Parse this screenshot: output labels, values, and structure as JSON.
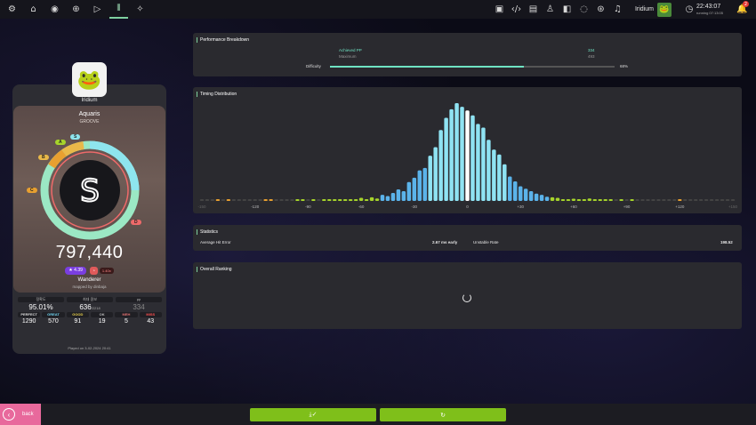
{
  "toolbar": {
    "left_icons": [
      "gear-icon",
      "home-icon",
      "record-icon",
      "discord-icon",
      "play-icon",
      "beatmap-listing-icon",
      "compass-icon"
    ],
    "right_icons": [
      "screenshot-icon",
      "code-icon",
      "news-icon",
      "rankings-icon",
      "beatmap-icon",
      "chat-icon",
      "direct-icon",
      "music-icon"
    ],
    "user_name": "Iridium",
    "clock_time": "22:43:07",
    "clock_sub": "running 07:13:05",
    "notification_count": "2"
  },
  "player": {
    "name": "Iridium"
  },
  "beatmap": {
    "title": "Aquaris",
    "difficulty": "GROOVE",
    "grade": "S",
    "grade_labels": [
      "S",
      "A",
      "B",
      "C",
      "D"
    ],
    "score": "797,440",
    "star_rating": "★ 4.39",
    "mods_label": "1.40x",
    "mapper": "Wanderer",
    "mapped_by_line": "mapped by dinbaja",
    "stats": [
      {
        "label": "정확도",
        "value": "95.01%",
        "extra": ""
      },
      {
        "label": "최대 콤보",
        "value": "636",
        "extra": "/2218"
      },
      {
        "label": "pp",
        "value": "334",
        "extra": ""
      }
    ],
    "judgements": [
      {
        "label": "PERFECT",
        "value": "1290",
        "color": "#dcdcdc"
      },
      {
        "label": "GREAT",
        "value": "570",
        "color": "#6fd3f0"
      },
      {
        "label": "GOOD",
        "value": "91",
        "color": "#e8d04a"
      },
      {
        "label": "OK",
        "value": "19",
        "color": "#bbbbbb"
      },
      {
        "label": "MEH",
        "value": "5",
        "color": "#e07070"
      },
      {
        "label": "MISS",
        "value": "43",
        "color": "#ff5050"
      }
    ],
    "played_on": "Played on 3-02-2024 20:41"
  },
  "performance": {
    "title": "Performance Breakdown",
    "achieved_label": "Achieved PP",
    "achieved_value": "334",
    "maximum_label": "Maximum",
    "maximum_value": "493",
    "difficulty_label": "Difficulty",
    "difficulty_value": "68%",
    "difficulty_fraction": 0.68
  },
  "timing": {
    "title": "Timing Distribution"
  },
  "statistics": {
    "title": "Statistics",
    "avg_hit_error_label": "Average Hit Error",
    "avg_hit_error_value": "2.67 ms early",
    "unstable_rate_label": "Unstable Rate",
    "unstable_rate_value": "198.52"
  },
  "ranking": {
    "title": "Overall Ranking"
  },
  "bottom": {
    "back_label": "back"
  },
  "chart_data": {
    "type": "bar",
    "x_ticks": [
      "-150",
      "-120",
      "-90",
      "-60",
      "-30",
      "0",
      "+30",
      "+60",
      "+90",
      "+120",
      "+150"
    ],
    "xlim": [
      -150,
      150
    ],
    "colors": {
      "center": "#ffffff",
      "great_light": "#8fe3f3",
      "great_dark": "#5bb3ea",
      "good": "#a6d42b",
      "meh": "#e8a030",
      "empty": "#444444"
    },
    "bins": [
      {
        "x": -150,
        "v": 0,
        "c": "empty"
      },
      {
        "x": -147,
        "v": 0,
        "c": "empty"
      },
      {
        "x": -144,
        "v": 0,
        "c": "empty"
      },
      {
        "x": -141,
        "v": 0.5,
        "c": "meh"
      },
      {
        "x": -138,
        "v": 0,
        "c": "empty"
      },
      {
        "x": -135,
        "v": 0.5,
        "c": "meh"
      },
      {
        "x": -132,
        "v": 0,
        "c": "empty"
      },
      {
        "x": -129,
        "v": 0,
        "c": "empty"
      },
      {
        "x": -126,
        "v": 0,
        "c": "empty"
      },
      {
        "x": -123,
        "v": 0,
        "c": "empty"
      },
      {
        "x": -120,
        "v": 0,
        "c": "empty"
      },
      {
        "x": -117,
        "v": 0,
        "c": "empty"
      },
      {
        "x": -114,
        "v": 0.5,
        "c": "meh"
      },
      {
        "x": -111,
        "v": 0.5,
        "c": "meh"
      },
      {
        "x": -108,
        "v": 0,
        "c": "empty"
      },
      {
        "x": -105,
        "v": 0,
        "c": "empty"
      },
      {
        "x": -102,
        "v": 0,
        "c": "empty"
      },
      {
        "x": -99,
        "v": 0,
        "c": "empty"
      },
      {
        "x": -96,
        "v": 0.6,
        "c": "good"
      },
      {
        "x": -93,
        "v": 0.8,
        "c": "good"
      },
      {
        "x": -90,
        "v": 0,
        "c": "empty"
      },
      {
        "x": -87,
        "v": 0.6,
        "c": "good"
      },
      {
        "x": -84,
        "v": 0,
        "c": "empty"
      },
      {
        "x": -81,
        "v": 0.6,
        "c": "good"
      },
      {
        "x": -78,
        "v": 1.0,
        "c": "good"
      },
      {
        "x": -75,
        "v": 0.6,
        "c": "good"
      },
      {
        "x": -72,
        "v": 0.8,
        "c": "good"
      },
      {
        "x": -69,
        "v": 1.5,
        "c": "good"
      },
      {
        "x": -66,
        "v": 1.0,
        "c": "good"
      },
      {
        "x": -63,
        "v": 1.5,
        "c": "good"
      },
      {
        "x": -60,
        "v": 2.5,
        "c": "good"
      },
      {
        "x": -57,
        "v": 1.2,
        "c": "good"
      },
      {
        "x": -54,
        "v": 3.0,
        "c": "good"
      },
      {
        "x": -51,
        "v": 2.0,
        "c": "good"
      },
      {
        "x": -48,
        "v": 5.0,
        "c": "great_dark"
      },
      {
        "x": -45,
        "v": 4.0,
        "c": "great_dark"
      },
      {
        "x": -42,
        "v": 6.5,
        "c": "great_dark"
      },
      {
        "x": -39,
        "v": 9.5,
        "c": "great_dark"
      },
      {
        "x": -36,
        "v": 8.0,
        "c": "great_dark"
      },
      {
        "x": -33,
        "v": 15.5,
        "c": "great_dark"
      },
      {
        "x": -30,
        "v": 19.0,
        "c": "great_dark"
      },
      {
        "x": -27,
        "v": 25.0,
        "c": "great_dark"
      },
      {
        "x": -24,
        "v": 27.0,
        "c": "great_dark"
      },
      {
        "x": -21,
        "v": 37.0,
        "c": "great_light"
      },
      {
        "x": -18,
        "v": 44.0,
        "c": "great_light"
      },
      {
        "x": -15,
        "v": 58.0,
        "c": "great_light"
      },
      {
        "x": -12,
        "v": 68.0,
        "c": "great_light"
      },
      {
        "x": -9,
        "v": 75.0,
        "c": "great_light"
      },
      {
        "x": -6,
        "v": 80.0,
        "c": "great_light"
      },
      {
        "x": -3,
        "v": 77.0,
        "c": "great_light"
      },
      {
        "x": 0,
        "v": 74.0,
        "c": "center"
      },
      {
        "x": 3,
        "v": 70.0,
        "c": "great_light"
      },
      {
        "x": 6,
        "v": 63.0,
        "c": "great_light"
      },
      {
        "x": 9,
        "v": 60.0,
        "c": "great_light"
      },
      {
        "x": 12,
        "v": 50.0,
        "c": "great_light"
      },
      {
        "x": 15,
        "v": 42.0,
        "c": "great_light"
      },
      {
        "x": 18,
        "v": 38.0,
        "c": "great_light"
      },
      {
        "x": 21,
        "v": 30.0,
        "c": "great_light"
      },
      {
        "x": 24,
        "v": 20.0,
        "c": "great_dark"
      },
      {
        "x": 27,
        "v": 16.0,
        "c": "great_dark"
      },
      {
        "x": 30,
        "v": 12.0,
        "c": "great_dark"
      },
      {
        "x": 33,
        "v": 10.0,
        "c": "great_dark"
      },
      {
        "x": 36,
        "v": 8.0,
        "c": "great_dark"
      },
      {
        "x": 39,
        "v": 6.0,
        "c": "great_dark"
      },
      {
        "x": 42,
        "v": 5.0,
        "c": "great_dark"
      },
      {
        "x": 45,
        "v": 3.5,
        "c": "great_dark"
      },
      {
        "x": 48,
        "v": 3.0,
        "c": "good"
      },
      {
        "x": 51,
        "v": 2.5,
        "c": "good"
      },
      {
        "x": 54,
        "v": 1.5,
        "c": "good"
      },
      {
        "x": 57,
        "v": 1.2,
        "c": "good"
      },
      {
        "x": 60,
        "v": 1.8,
        "c": "good"
      },
      {
        "x": 63,
        "v": 1.0,
        "c": "good"
      },
      {
        "x": 66,
        "v": 0.6,
        "c": "good"
      },
      {
        "x": 69,
        "v": 2.0,
        "c": "good"
      },
      {
        "x": 72,
        "v": 0.8,
        "c": "good"
      },
      {
        "x": 75,
        "v": 0.6,
        "c": "good"
      },
      {
        "x": 78,
        "v": 0.5,
        "c": "good"
      },
      {
        "x": 81,
        "v": 0.6,
        "c": "good"
      },
      {
        "x": 84,
        "v": 0,
        "c": "empty"
      },
      {
        "x": 87,
        "v": 0.6,
        "c": "good"
      },
      {
        "x": 90,
        "v": 0,
        "c": "empty"
      },
      {
        "x": 93,
        "v": 0.5,
        "c": "good"
      },
      {
        "x": 96,
        "v": 0,
        "c": "empty"
      },
      {
        "x": 99,
        "v": 0,
        "c": "empty"
      },
      {
        "x": 102,
        "v": 0,
        "c": "empty"
      },
      {
        "x": 105,
        "v": 0,
        "c": "empty"
      },
      {
        "x": 108,
        "v": 0,
        "c": "empty"
      },
      {
        "x": 111,
        "v": 0,
        "c": "empty"
      },
      {
        "x": 114,
        "v": 0,
        "c": "empty"
      },
      {
        "x": 117,
        "v": 0,
        "c": "empty"
      },
      {
        "x": 120,
        "v": 0.5,
        "c": "meh"
      },
      {
        "x": 123,
        "v": 0,
        "c": "empty"
      },
      {
        "x": 126,
        "v": 0,
        "c": "empty"
      },
      {
        "x": 129,
        "v": 0,
        "c": "empty"
      },
      {
        "x": 132,
        "v": 0,
        "c": "empty"
      },
      {
        "x": 135,
        "v": 0,
        "c": "empty"
      },
      {
        "x": 138,
        "v": 0,
        "c": "empty"
      },
      {
        "x": 141,
        "v": 0,
        "c": "empty"
      },
      {
        "x": 144,
        "v": 0,
        "c": "empty"
      },
      {
        "x": 147,
        "v": 0,
        "c": "empty"
      },
      {
        "x": 150,
        "v": 0,
        "c": "empty"
      }
    ],
    "ylim": [
      0,
      80
    ]
  }
}
